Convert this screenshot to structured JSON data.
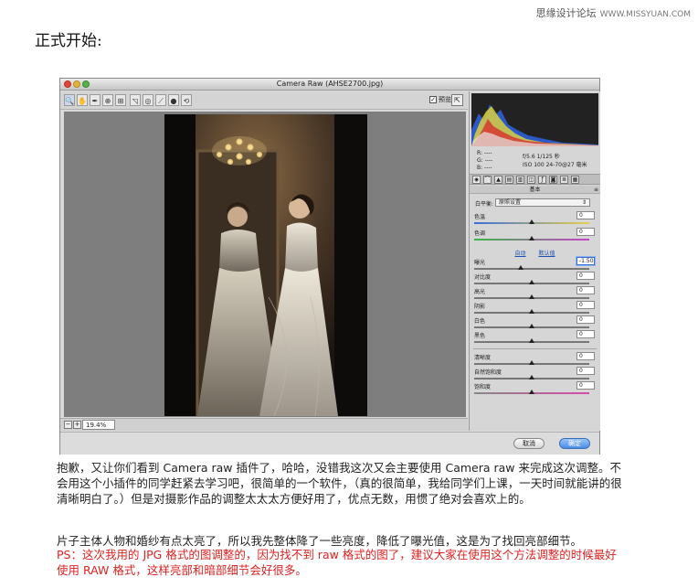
{
  "watermark": {
    "text": "思缘设计论坛",
    "site": "WWW.MISSYUAN.COM"
  },
  "heading": "正式开始:",
  "window": {
    "title": "Camera Raw (AHSE2700.jpg)",
    "preview_label": "预览",
    "zoom": "19.4%",
    "cancel": "取消",
    "ok": "确定"
  },
  "tools": [
    "🔍",
    "✋",
    "✒",
    "⊕",
    "⊞",
    "◹",
    "◎",
    "⟋",
    "●",
    "⟲"
  ],
  "info": {
    "r": "R: ----",
    "g": "G: ----",
    "b": "B: ----",
    "exif_line1": "f/5.6   1/125 秒",
    "exif_line2": "ISO 100   24-70@27 毫米"
  },
  "panel": {
    "section_title": "基本",
    "wb_label": "白平衡:",
    "wb_value": "原照设置",
    "auto": "自动",
    "default": "默认值",
    "sliders": {
      "temperature": {
        "label": "色温",
        "value": "0"
      },
      "tint": {
        "label": "色调",
        "value": "0"
      },
      "exposure": {
        "label": "曝光",
        "value": "-1.50"
      },
      "contrast": {
        "label": "对比度",
        "value": "0"
      },
      "highlights": {
        "label": "高光",
        "value": "0"
      },
      "shadows": {
        "label": "阴影",
        "value": "0"
      },
      "whites": {
        "label": "白色",
        "value": "0"
      },
      "blacks": {
        "label": "黑色",
        "value": "0"
      },
      "clarity": {
        "label": "清晰度",
        "value": "0"
      },
      "vibrance": {
        "label": "自然饱和度",
        "value": "0"
      },
      "saturation": {
        "label": "饱和度",
        "value": "0"
      }
    }
  },
  "text": {
    "p1": "抱歉，又让你们看到 Camera raw 插件了，哈哈，没错我这次又会主要使用 Camera raw 来完成这次调整。不会用这个小插件的同学赶紧去学习吧，很简单的一个软件，（真的很简单，我给同学们上课，一天时间就能讲的很清晰明白了。）但是对摄影作品的调整太太太方便好用了，优点无数，用惯了绝对会喜欢上的。",
    "p2": "片子主体人物和婚纱有点太亮了，所以我先整体降了一些亮度，降低了曝光值，这是为了找回亮部细节。",
    "p3": "PS：这次我用的 JPG 格式的图调整的，因为找不到 raw 格式的图了，建议大家在使用这个方法调整的时候最好使用 RAW 格式，这样亮部和暗部细节会好很多。"
  }
}
